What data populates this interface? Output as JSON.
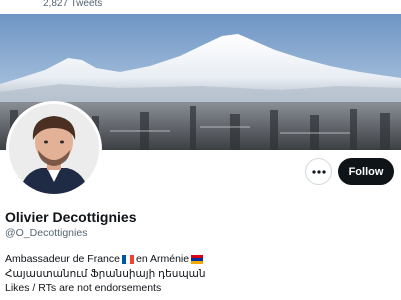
{
  "header": {
    "tweet_count": "2,827 Tweets"
  },
  "profile": {
    "name": "Olivier Decottignies",
    "handle": "@O_Decottignies",
    "bio": {
      "line1_part1": "Ambassadeur de France",
      "line1_part2": " en Arménie",
      "line2": "Հայաստանում Ֆրանսիայի դեսպան",
      "line3": "Likes / RTs are not endorsements"
    },
    "flags": [
      "france-flag",
      "armenia-flag"
    ]
  },
  "actions": {
    "more_icon": "more-horizontal-icon",
    "follow_label": "Follow"
  },
  "colors": {
    "text_primary": "#0f1419",
    "text_secondary": "#536471",
    "follow_bg": "#0f1419",
    "border": "#cfd9de"
  }
}
